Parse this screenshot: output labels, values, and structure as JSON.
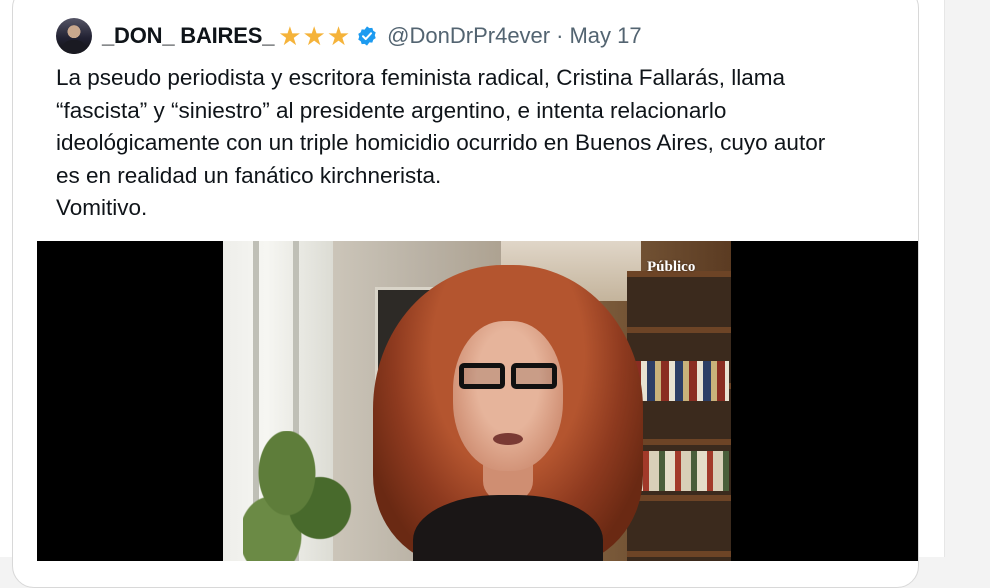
{
  "tweet": {
    "display_name": "_DON_ BAIRES_",
    "name_badges": [
      "star-icon",
      "star-icon",
      "star-icon"
    ],
    "verified": true,
    "handle": "@DonDrPr4ever",
    "separator": "·",
    "date": "May 17",
    "text": "La pseudo periodista y escritora feminista radical, Cristina Fallarás, llama\n“fascista” y “siniestro” al presidente argentino, e intenta relacionarlo\nideológicamente con un triple homicidio ocurrido en Buenos Aires, cuyo autor\nes en realidad un fanático kirchnerista.\nVomitivo."
  },
  "media": {
    "watermark": "Público"
  },
  "colors": {
    "star": "#f5b33a",
    "verified": "#1d9bf0",
    "secondary_text": "#536471",
    "primary_text": "#0f1419"
  }
}
